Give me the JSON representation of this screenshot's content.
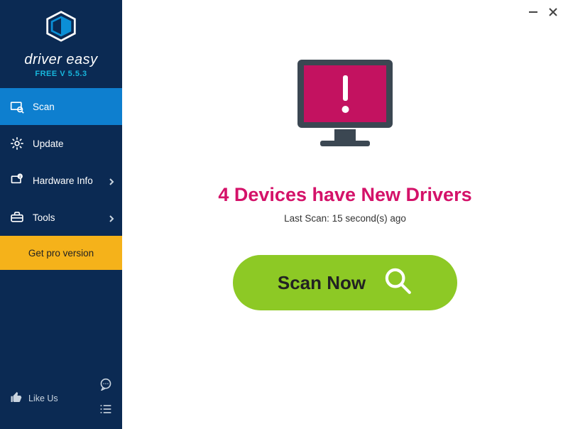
{
  "brand": {
    "name": "driver easy",
    "subtitle": "FREE V 5.5.3"
  },
  "nav": {
    "scan": "Scan",
    "update": "Update",
    "hardware_info": "Hardware Info",
    "tools": "Tools"
  },
  "pro_label": "Get pro version",
  "bottom": {
    "like_us": "Like Us"
  },
  "main": {
    "headline": "4 Devices have New Drivers",
    "last_scan": "Last Scan: 15 second(s) ago",
    "scan_button": "Scan Now"
  }
}
